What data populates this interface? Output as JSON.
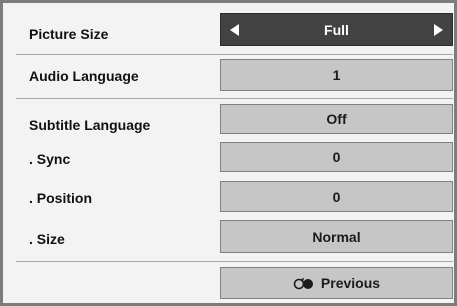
{
  "menu": {
    "rows": [
      {
        "label": "Picture Size",
        "value": "Full"
      },
      {
        "label": "Audio Language",
        "value": "1"
      },
      {
        "label": "Subtitle Language",
        "value": "Off"
      },
      {
        "label": ". Sync",
        "value": "0"
      },
      {
        "label": ". Position",
        "value": "0"
      },
      {
        "label": ". Size",
        "value": "Normal"
      }
    ],
    "previous_label": "Previous"
  },
  "icons": {
    "left": "triangle-left-icon",
    "right": "triangle-right-icon",
    "previous": "return-icon"
  },
  "colors": {
    "active_button": "#424242",
    "button": "#c6c6c6",
    "panel": "#f3f3f3"
  }
}
